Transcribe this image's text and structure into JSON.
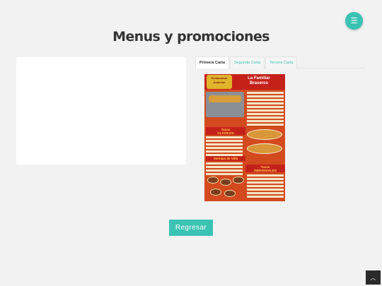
{
  "header": {
    "menu_icon": "hamburger-icon"
  },
  "page": {
    "title": "Menus y promociones"
  },
  "tabs": [
    {
      "label": "Primera Carta"
    },
    {
      "label": "Segunda Carta"
    },
    {
      "label": "Tercera Carta"
    }
  ],
  "poster": {
    "logo_text": "Restaurante Anaheim",
    "brand": "La Familiar\nBraseros",
    "section_tacos": "Tacos\nCLÁSICOS",
    "section_veredas": "Veredas de Villa",
    "section_tacos_indiv": "Tacos\nINDIVIDUALES"
  },
  "actions": {
    "back_label": "Regresar"
  },
  "footer": {
    "scroll_top_icon": "chevron-up-icon"
  },
  "colors": {
    "accent": "#3ac2b3",
    "poster_red": "#c5211b"
  }
}
